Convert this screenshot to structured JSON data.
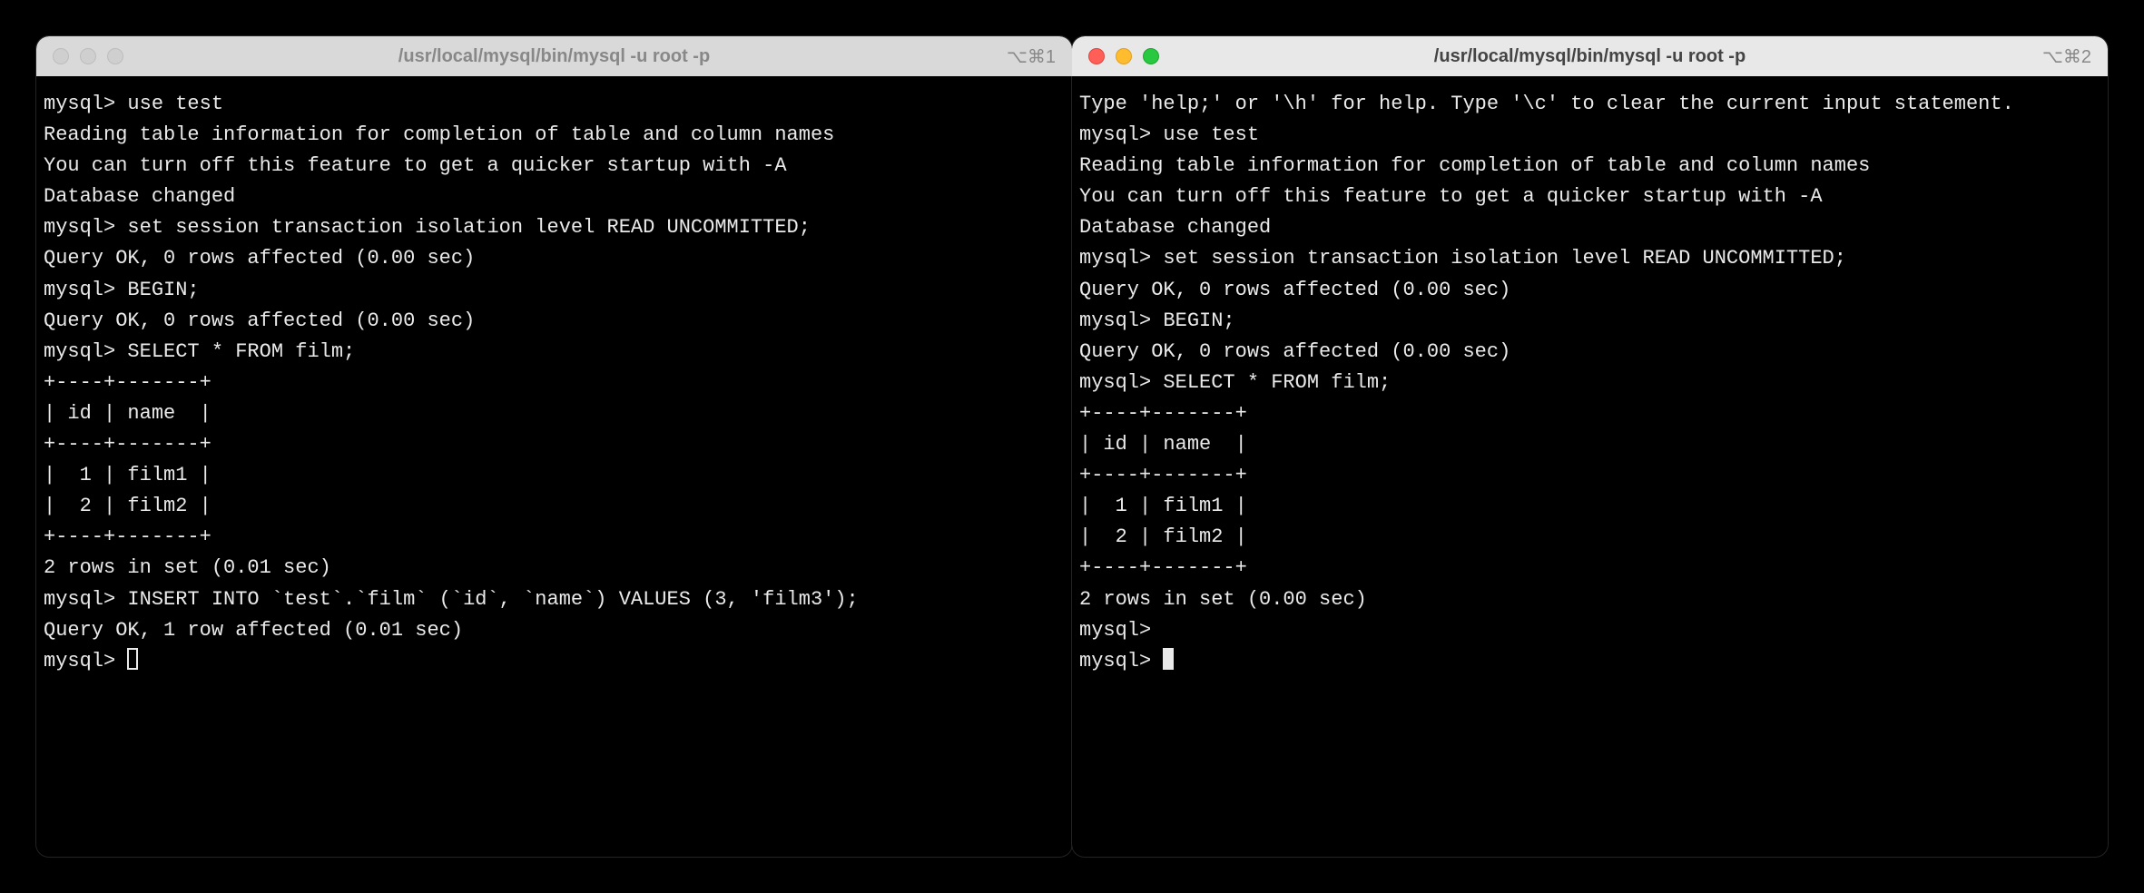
{
  "left": {
    "active": false,
    "title": "/usr/local/mysql/bin/mysql -u root -p",
    "shortcut": "⌥⌘1",
    "lines": [
      "mysql> use test",
      "Reading table information for completion of table and column names",
      "You can turn off this feature to get a quicker startup with -A",
      "",
      "Database changed",
      "mysql> set session transaction isolation level READ UNCOMMITTED;",
      "Query OK, 0 rows affected (0.00 sec)",
      "",
      "mysql> BEGIN;",
      "Query OK, 0 rows affected (0.00 sec)",
      "",
      "mysql> SELECT * FROM film;",
      "+----+-------+",
      "| id | name  |",
      "+----+-------+",
      "|  1 | film1 |",
      "|  2 | film2 |",
      "+----+-------+",
      "2 rows in set (0.01 sec)",
      "",
      "mysql> INSERT INTO `test`.`film` (`id`, `name`) VALUES (3, 'film3');",
      "Query OK, 1 row affected (0.01 sec)",
      "",
      "mysql> "
    ],
    "cursor": "hollow"
  },
  "right": {
    "active": true,
    "title": "/usr/local/mysql/bin/mysql -u root -p",
    "shortcut": "⌥⌘2",
    "lines": [
      "Type 'help;' or '\\h' for help. Type '\\c' to clear the current input statement.",
      "",
      "mysql> use test",
      "Reading table information for completion of table and column names",
      "You can turn off this feature to get a quicker startup with -A",
      "",
      "Database changed",
      "mysql> set session transaction isolation level READ UNCOMMITTED;",
      "Query OK, 0 rows affected (0.00 sec)",
      "",
      "mysql> BEGIN;",
      "Query OK, 0 rows affected (0.00 sec)",
      "",
      "mysql> SELECT * FROM film;",
      "+----+-------+",
      "| id | name  |",
      "+----+-------+",
      "|  1 | film1 |",
      "|  2 | film2 |",
      "+----+-------+",
      "2 rows in set (0.00 sec)",
      "",
      "mysql> ",
      "mysql> "
    ],
    "cursor": "block"
  }
}
